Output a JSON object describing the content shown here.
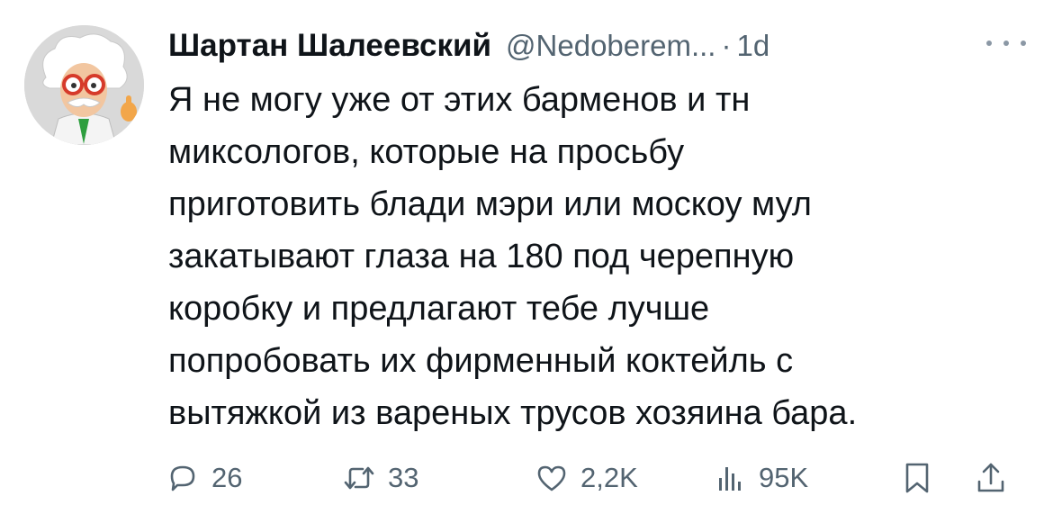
{
  "tweet": {
    "author_name": "Шартан Шалеевский",
    "author_handle": "@Nedoberem...",
    "separator": "·",
    "time": "1d",
    "text_lines": [
      "Я не могу уже от этих барменов и тн",
      "миксологов, которые на просьбу",
      "приготовить блади мэри или москоу мул",
      "закатывают глаза на 180 под черепную",
      "коробку и предлагают тебе лучше",
      "попробовать их фирменный коктейль с",
      "вытяжкой из вареных трусов хозяина бара."
    ]
  },
  "actions": {
    "replies": "26",
    "retweets": "33",
    "likes": "2,2K",
    "views": "95K"
  },
  "icons": {
    "avatar": "cartoon-scientist-avatar",
    "more": "more-dots-icon",
    "reply": "reply-bubble-icon",
    "retweet": "retweet-arrows-icon",
    "like": "heart-icon",
    "views": "views-bar-chart-icon",
    "bookmark": "bookmark-icon",
    "share": "share-upload-icon"
  },
  "colors": {
    "text": "#0f1419",
    "secondary": "#536471",
    "background": "#ffffff"
  }
}
